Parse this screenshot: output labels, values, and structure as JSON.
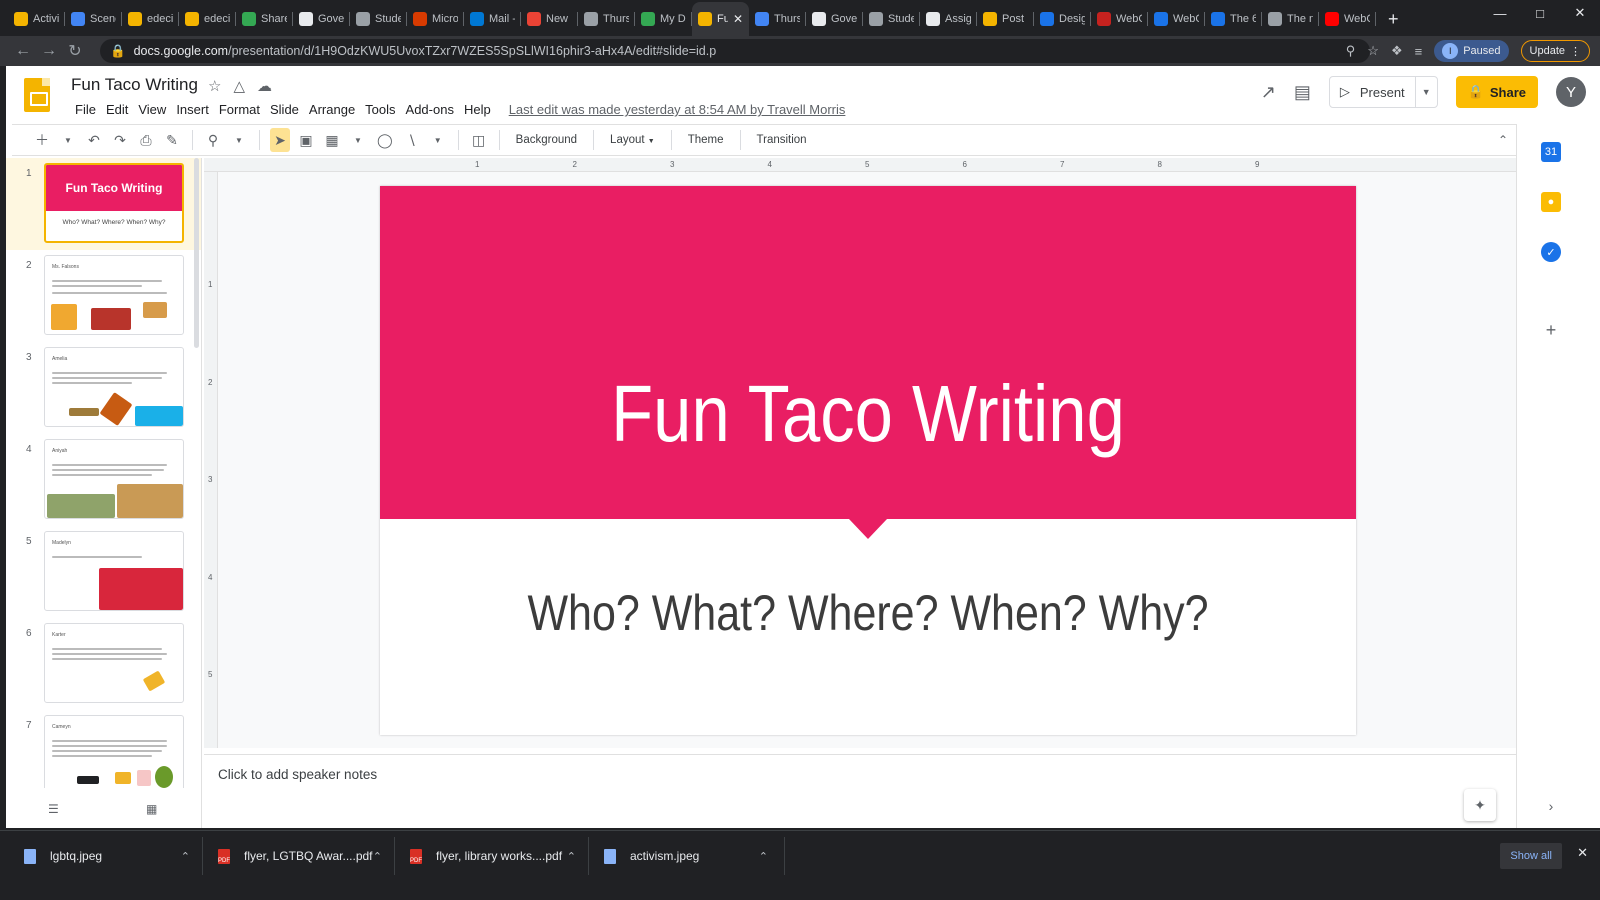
{
  "browser": {
    "tabs": [
      {
        "label": "Activi",
        "color": "#f4b400"
      },
      {
        "label": "Scenc",
        "color": "#4285f4"
      },
      {
        "label": "edeci",
        "color": "#f4b400"
      },
      {
        "label": "edeci",
        "color": "#f4b400"
      },
      {
        "label": "Share",
        "color": "#34a853"
      },
      {
        "label": "Gove",
        "color": "#e8eaed"
      },
      {
        "label": "Stude",
        "color": "#9aa0a6"
      },
      {
        "label": "Micro",
        "color": "#d83b01"
      },
      {
        "label": "Mail -",
        "color": "#0078d4"
      },
      {
        "label": "New",
        "color": "#ea4335"
      },
      {
        "label": "Thurs",
        "color": "#9aa0a6"
      },
      {
        "label": "My D",
        "color": "#34a853"
      },
      {
        "label": "Fu",
        "color": "#f4b400",
        "active": true
      },
      {
        "label": "Thurs",
        "color": "#4285f4"
      },
      {
        "label": "Gove",
        "color": "#e8eaed"
      },
      {
        "label": "Stude",
        "color": "#9aa0a6"
      },
      {
        "label": "Assig",
        "color": "#e8eaed"
      },
      {
        "label": "Post",
        "color": "#f4b400"
      },
      {
        "label": "Desig",
        "color": "#1a73e8"
      },
      {
        "label": "WebC",
        "color": "#c5221f"
      },
      {
        "label": "WebC",
        "color": "#1a73e8"
      },
      {
        "label": "The 6",
        "color": "#1a73e8"
      },
      {
        "label": "The n",
        "color": "#9aa0a6"
      },
      {
        "label": "WebC",
        "color": "#ff0000"
      }
    ],
    "url_domain": "docs.google.com",
    "url_path": "/presentation/d/1H9OdzKWU5UvoxTZxr7WZES5SpSLlWI16phir3-aHx4A/edit#slide=id.p",
    "profile_initial": "I",
    "profile_status": "Paused",
    "update_label": "Update"
  },
  "app": {
    "doc_title": "Fun Taco Writing",
    "menus": [
      "File",
      "Edit",
      "View",
      "Insert",
      "Format",
      "Slide",
      "Arrange",
      "Tools",
      "Add-ons",
      "Help"
    ],
    "last_edit": "Last edit was made yesterday at 8:54 AM by Travell Morris",
    "present_label": "Present",
    "share_label": "Share",
    "avatar_initial": "Y",
    "brand_color": "#f4b400",
    "share_color": "#fbbc04"
  },
  "toolbar": {
    "background_label": "Background",
    "layout_label": "Layout",
    "theme_label": "Theme",
    "transition_label": "Transition"
  },
  "filmstrip": {
    "slides": [
      {
        "number": "1",
        "title": "Fun Taco Writing",
        "subtitle": "Who? What? Where? When? Why?"
      },
      {
        "number": "2",
        "name": "Ms. Falsons"
      },
      {
        "number": "3",
        "name": "Amelia"
      },
      {
        "number": "4",
        "name": "Aniyah"
      },
      {
        "number": "5",
        "name": "Madelyn"
      },
      {
        "number": "6",
        "name": "Karter"
      },
      {
        "number": "7",
        "name": "Cameyn"
      }
    ]
  },
  "ruler": {
    "h_marks": [
      "1",
      "2",
      "3",
      "4",
      "5",
      "6",
      "7",
      "8",
      "9"
    ],
    "v_marks": [
      "1",
      "2",
      "3",
      "4",
      "5"
    ]
  },
  "slide": {
    "title": "Fun Taco Writing",
    "subtitle": "Who? What? Where? When? Why?",
    "accent_color": "#e91e63"
  },
  "notes": {
    "placeholder": "Click to add speaker notes"
  },
  "downloads": {
    "items": [
      {
        "name": "lgbtq.jpeg",
        "type": "image"
      },
      {
        "name": "flyer, LGTBQ Awar....pdf",
        "type": "pdf"
      },
      {
        "name": "flyer, library works....pdf",
        "type": "pdf"
      },
      {
        "name": "activism.jpeg",
        "type": "image"
      }
    ],
    "show_all": "Show all"
  }
}
